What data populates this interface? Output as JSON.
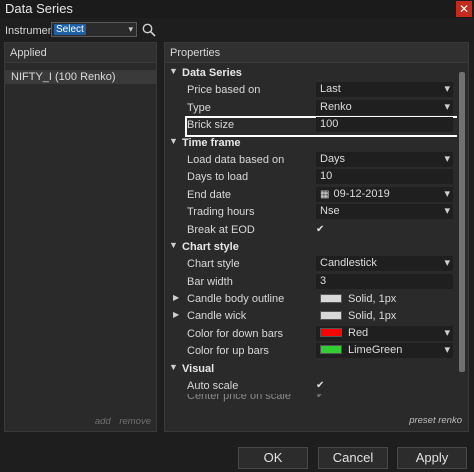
{
  "window": {
    "title": "Data Series",
    "close_glyph": "✕"
  },
  "instrument": {
    "label": "Instrument",
    "value": "Select"
  },
  "applied": {
    "header": "Applied",
    "items": [
      "NIFTY_I (100 Renko)"
    ],
    "add_label": "add",
    "remove_label": "remove"
  },
  "properties": {
    "header": "Properties",
    "preset_label": "preset renko",
    "data_series": {
      "title": "Data Series",
      "price_based_on": {
        "label": "Price based on",
        "value": "Last"
      },
      "type": {
        "label": "Type",
        "value": "Renko"
      },
      "brick_size": {
        "label": "Brick size",
        "value": "100"
      }
    },
    "time_frame": {
      "title": "Time frame",
      "load_data_based_on": {
        "label": "Load data based on",
        "value": "Days"
      },
      "days_to_load": {
        "label": "Days to load",
        "value": "10"
      },
      "end_date": {
        "label": "End date",
        "value": "09-12-2019"
      },
      "trading_hours": {
        "label": "Trading hours",
        "value": "Nse"
      },
      "break_at_eod": {
        "label": "Break at EOD",
        "checked": true
      }
    },
    "chart_style": {
      "title": "Chart style",
      "chart_style": {
        "label": "Chart style",
        "value": "Candlestick"
      },
      "bar_width": {
        "label": "Bar width",
        "value": "3"
      },
      "candle_body_outline": {
        "label": "Candle body outline",
        "value": "Solid, 1px",
        "color": "#d9d9d9"
      },
      "candle_wick": {
        "label": "Candle wick",
        "value": "Solid, 1px",
        "color": "#d9d9d9"
      },
      "color_down_bars": {
        "label": "Color for down bars",
        "value": "Red",
        "color": "#ff0000"
      },
      "color_up_bars": {
        "label": "Color for up bars",
        "value": "LimeGreen",
        "color": "#32cd32"
      }
    },
    "visual": {
      "title": "Visual",
      "auto_scale": {
        "label": "Auto scale",
        "checked": true
      },
      "center_price": {
        "label": "Center price on scale"
      }
    }
  },
  "buttons": {
    "ok": "OK",
    "cancel": "Cancel",
    "apply": "Apply"
  },
  "colors": {
    "highlight_border": "#ffffff",
    "accent_selected": "#1f5fa6",
    "close_button": "#c42b1c"
  }
}
